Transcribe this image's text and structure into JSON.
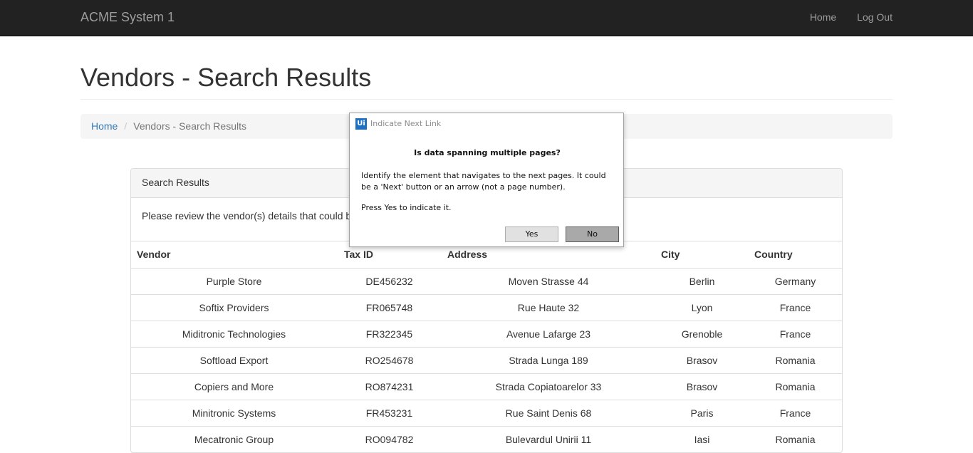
{
  "navbar": {
    "brand": "ACME System 1",
    "links": [
      "Home",
      "Log Out"
    ]
  },
  "page": {
    "title": "Vendors - Search Results"
  },
  "breadcrumb": {
    "home": "Home",
    "separator": "/",
    "current": "Vendors - Search Results"
  },
  "panel": {
    "heading": "Search Results",
    "message": "Please review the vendor(s) details that could b"
  },
  "table": {
    "headers": [
      "Vendor",
      "Tax ID",
      "Address",
      "City",
      "Country"
    ],
    "rows": [
      [
        "Purple Store",
        "DE456232",
        "Moven Strasse 44",
        "Berlin",
        "Germany"
      ],
      [
        "Softix Providers",
        "FR065748",
        "Rue Haute 32",
        "Lyon",
        "France"
      ],
      [
        "Miditronic Technologies",
        "FR322345",
        "Avenue Lafarge 23",
        "Grenoble",
        "France"
      ],
      [
        "Softload Export",
        "RO254678",
        "Strada Lunga 189",
        "Brasov",
        "Romania"
      ],
      [
        "Copiers and More",
        "RO874231",
        "Strada Copiatoarelor 33",
        "Brasov",
        "Romania"
      ],
      [
        "Minitronic Systems",
        "FR453231",
        "Rue Saint Denis 68",
        "Paris",
        "France"
      ],
      [
        "Mecatronic Group",
        "RO094782",
        "Bulevardul Unirii 11",
        "Iasi",
        "Romania"
      ]
    ]
  },
  "dialog": {
    "logo": "Ui",
    "title": "Indicate Next Link",
    "question": "Is data spanning multiple pages?",
    "message": "Identify the element that navigates to the next pages. It could be a 'Next' button or an arrow (not a page number).",
    "instruction": "Press Yes to indicate it.",
    "yes_label": "Yes",
    "no_label": "No"
  }
}
